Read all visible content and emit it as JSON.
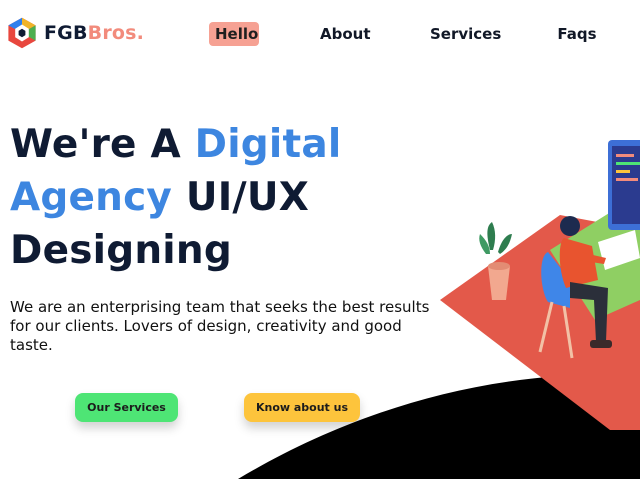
{
  "brand": {
    "name_main": "FGB",
    "name_accent": "Bros.",
    "icon": "hexagon-logo-icon",
    "colors": {
      "dark": "#0f1b33",
      "accent": "#f28b7c"
    }
  },
  "nav": {
    "items": [
      {
        "label": "Hello",
        "active": true
      },
      {
        "label": "About",
        "active": false
      },
      {
        "label": "Services",
        "active": false
      },
      {
        "label": "Faqs",
        "active": false
      }
    ],
    "active_bg": "#f6a193"
  },
  "hero": {
    "line1_a": "We're A ",
    "line1_b": "Digital",
    "line2_a": "Agency",
    "line2_b": " UI/UX",
    "line3": "Designing",
    "description": "We are an enterprising team that seeks the best results for our clients. Lovers of design, creativity and good taste.",
    "accent_color": "#3d86e0"
  },
  "buttons": {
    "primary": {
      "label": "Our Services",
      "color": "#4ee575"
    },
    "secondary": {
      "label": "Know about us",
      "color": "#fdc43c"
    }
  },
  "illustration": {
    "icon": "designer-at-desk-illustration"
  }
}
